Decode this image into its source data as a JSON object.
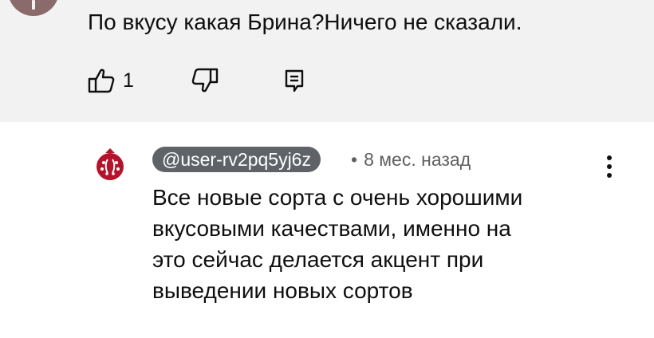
{
  "previous_comment": {
    "text": "По вкусу какая Брина?Ничего не сказали.",
    "like_count": "1"
  },
  "comment": {
    "author": "@user-rv2pq5yj6z",
    "separator": "•",
    "timestamp": "8 мес. назад",
    "body_lines": [
      "Все новые сорта с очень хорошими",
      "вкусовыми качествами, именно на",
      "это сейчас делается акцент при",
      "выведении новых сортов"
    ],
    "avatar_colors": {
      "primary": "#b5132c",
      "accent": "#ffffff"
    }
  },
  "colors": {
    "top_background": "#f2f2f2",
    "author_chip": "#5f6368",
    "meta_text": "#606060"
  }
}
